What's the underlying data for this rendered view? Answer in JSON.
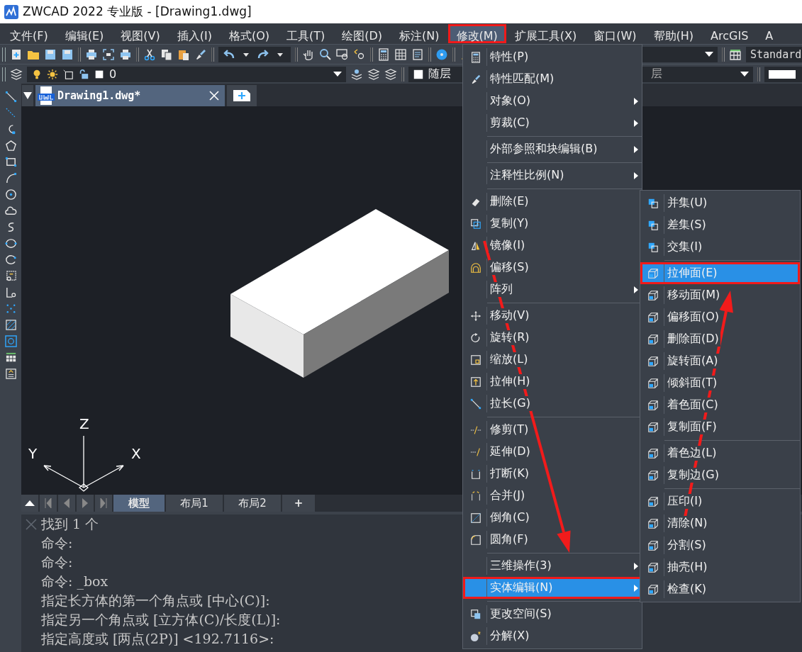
{
  "window": {
    "title": "ZWCAD 2022 专业版 - [Drawing1.dwg]"
  },
  "menubar": [
    {
      "label": "文件(F)",
      "selected": false,
      "highlighted": false
    },
    {
      "label": "编辑(E)",
      "selected": false,
      "highlighted": false
    },
    {
      "label": "视图(V)",
      "selected": false,
      "highlighted": false
    },
    {
      "label": "插入(I)",
      "selected": false,
      "highlighted": false
    },
    {
      "label": "格式(O)",
      "selected": false,
      "highlighted": false
    },
    {
      "label": "工具(T)",
      "selected": false,
      "highlighted": false
    },
    {
      "label": "绘图(D)",
      "selected": false,
      "highlighted": false
    },
    {
      "label": "标注(N)",
      "selected": false,
      "highlighted": false
    },
    {
      "label": "修改(M)",
      "selected": true,
      "highlighted": true
    },
    {
      "label": "扩展工具(X)",
      "selected": false,
      "highlighted": false
    },
    {
      "label": "窗口(W)",
      "selected": false,
      "highlighted": false
    },
    {
      "label": "帮助(H)",
      "selected": false,
      "highlighted": false
    },
    {
      "label": "ArcGIS",
      "selected": false,
      "highlighted": false
    },
    {
      "label": "A",
      "selected": false,
      "highlighted": false
    }
  ],
  "toolbar": {
    "table_style": "Standard",
    "layer": "0",
    "color_setting": "随层",
    "linetype": "层"
  },
  "document_tabs": [
    {
      "label": "Drawing1.dwg*",
      "selected": true
    }
  ],
  "drawing": {
    "ucs": {
      "x": "X",
      "y": "Y",
      "z": "Z"
    }
  },
  "layout_tabs": [
    {
      "label": "模型",
      "selected": true
    },
    {
      "label": "布局1",
      "selected": false
    },
    {
      "label": "布局2",
      "selected": false
    }
  ],
  "add_layout_label": "+",
  "command_lines": [
    "找到 1 个",
    "命令:",
    "命令:",
    "命令: _box",
    "指定长方体的第一个角点或 [中心(C)]:",
    "指定另一个角点或 [立方体(C)/长度(L)]:",
    "指定高度或 [两点(2P)] <192.7116>:"
  ],
  "menu": {
    "groups": [
      [
        {
          "label": "特性(P)",
          "has_submenu": false,
          "selected": false,
          "highlighted": false
        },
        {
          "label": "特性匹配(M)",
          "has_submenu": false,
          "selected": false,
          "highlighted": false
        },
        {
          "label": "对象(O)",
          "has_submenu": true,
          "selected": false,
          "highlighted": false
        },
        {
          "label": "剪裁(C)",
          "has_submenu": true,
          "selected": false,
          "highlighted": false
        }
      ],
      [
        {
          "label": "外部参照和块编辑(B)",
          "has_submenu": true,
          "selected": false,
          "highlighted": false
        }
      ],
      [
        {
          "label": "注释性比例(N)",
          "has_submenu": true,
          "selected": false,
          "highlighted": false
        }
      ],
      [
        {
          "label": "删除(E)",
          "has_submenu": false,
          "selected": false,
          "highlighted": false
        },
        {
          "label": "复制(Y)",
          "has_submenu": false,
          "selected": false,
          "highlighted": false
        },
        {
          "label": "镜像(I)",
          "has_submenu": false,
          "selected": false,
          "highlighted": false
        },
        {
          "label": "偏移(S)",
          "has_submenu": false,
          "selected": false,
          "highlighted": false
        },
        {
          "label": "阵列",
          "has_submenu": true,
          "selected": false,
          "highlighted": false
        }
      ],
      [
        {
          "label": "移动(V)",
          "has_submenu": false,
          "selected": false,
          "highlighted": false
        },
        {
          "label": "旋转(R)",
          "has_submenu": false,
          "selected": false,
          "highlighted": false
        },
        {
          "label": "缩放(L)",
          "has_submenu": false,
          "selected": false,
          "highlighted": false
        },
        {
          "label": "拉伸(H)",
          "has_submenu": false,
          "selected": false,
          "highlighted": false
        },
        {
          "label": "拉长(G)",
          "has_submenu": false,
          "selected": false,
          "highlighted": false
        }
      ],
      [
        {
          "label": "修剪(T)",
          "has_submenu": false,
          "selected": false,
          "highlighted": false
        },
        {
          "label": "延伸(D)",
          "has_submenu": false,
          "selected": false,
          "highlighted": false
        },
        {
          "label": "打断(K)",
          "has_submenu": false,
          "selected": false,
          "highlighted": false
        },
        {
          "label": "合并(J)",
          "has_submenu": false,
          "selected": false,
          "highlighted": false
        },
        {
          "label": "倒角(C)",
          "has_submenu": false,
          "selected": false,
          "highlighted": false
        },
        {
          "label": "圆角(F)",
          "has_submenu": false,
          "selected": false,
          "highlighted": false
        }
      ],
      [
        {
          "label": "三维操作(3)",
          "has_submenu": true,
          "selected": false,
          "highlighted": false
        },
        {
          "label": "实体编辑(N)",
          "has_submenu": true,
          "selected": true,
          "highlighted": true
        }
      ],
      [
        {
          "label": "更改空间(S)",
          "has_submenu": false,
          "selected": false,
          "highlighted": false
        },
        {
          "label": "分解(X)",
          "has_submenu": false,
          "selected": false,
          "highlighted": false
        }
      ]
    ]
  },
  "submenu": {
    "groups": [
      [
        {
          "label": "并集(U)",
          "selected": false,
          "highlighted": false
        },
        {
          "label": "差集(S)",
          "selected": false,
          "highlighted": false
        },
        {
          "label": "交集(I)",
          "selected": false,
          "highlighted": false
        }
      ],
      [
        {
          "label": "拉伸面(E)",
          "selected": true,
          "highlighted": true
        },
        {
          "label": "移动面(M)",
          "selected": false,
          "highlighted": false
        },
        {
          "label": "偏移面(O)",
          "selected": false,
          "highlighted": false
        },
        {
          "label": "删除面(D)",
          "selected": false,
          "highlighted": false
        },
        {
          "label": "旋转面(A)",
          "selected": false,
          "highlighted": false
        },
        {
          "label": "倾斜面(T)",
          "selected": false,
          "highlighted": false
        },
        {
          "label": "着色面(C)",
          "selected": false,
          "highlighted": false
        },
        {
          "label": "复制面(F)",
          "selected": false,
          "highlighted": false
        }
      ],
      [
        {
          "label": "着色边(L)",
          "selected": false,
          "highlighted": false
        },
        {
          "label": "复制边(G)",
          "selected": false,
          "highlighted": false
        }
      ],
      [
        {
          "label": "压印(I)",
          "selected": false,
          "highlighted": false
        },
        {
          "label": "清除(N)",
          "selected": false,
          "highlighted": false
        },
        {
          "label": "分割(S)",
          "selected": false,
          "highlighted": false
        },
        {
          "label": "抽壳(H)",
          "selected": false,
          "highlighted": false
        },
        {
          "label": "检查(K)",
          "selected": false,
          "highlighted": false
        }
      ]
    ]
  }
}
